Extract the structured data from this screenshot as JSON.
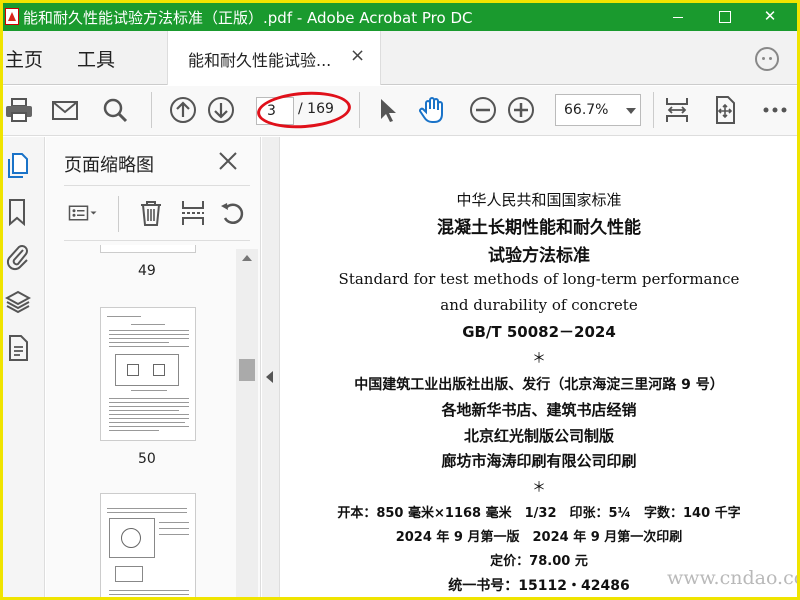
{
  "window": {
    "title": "能和耐久性能试验方法标准（正版）.pdf - Adobe Acrobat Pro DC"
  },
  "tabs": {
    "home": "主页",
    "tools": "工具",
    "document": "能和耐久性能试验...",
    "close": "×"
  },
  "toolbar": {
    "page_current": "3",
    "page_total": "/ 169",
    "zoom": "66.7%"
  },
  "thumbnails": {
    "title": "页面缩略图",
    "pages": [
      {
        "number": "49"
      },
      {
        "number": "50"
      }
    ]
  },
  "document": {
    "lines": [
      "中华人民共和国国家标准",
      "混凝土长期性能和耐久性能",
      "试验方法标准",
      "Standard for test methods of long-term performance",
      "and durability of concrete",
      "GB/T 50082－2024",
      "＊",
      "中国建筑工业出版社出版、发行（北京海淀三里河路 9 号）",
      "各地新华书店、建筑书店经销",
      "北京红光制版公司制版",
      "廊坊市海涛印刷有限公司印刷",
      "＊",
      "开本：850 毫米×1168 毫米　1/32　印张：5¼　字数：140 千字",
      "2024 年 9 月第一版　2024 年 9 月第一次印刷",
      "定价：78.00 元",
      "统一书号：15112・42486"
    ]
  },
  "watermark": {
    "text": "www.cndao.com"
  },
  "colors": {
    "titlebar": "#1a9a2e",
    "highlight": "#e0101a",
    "hand_tool": "#1a73c8",
    "rail_active": "#1a73c8"
  }
}
